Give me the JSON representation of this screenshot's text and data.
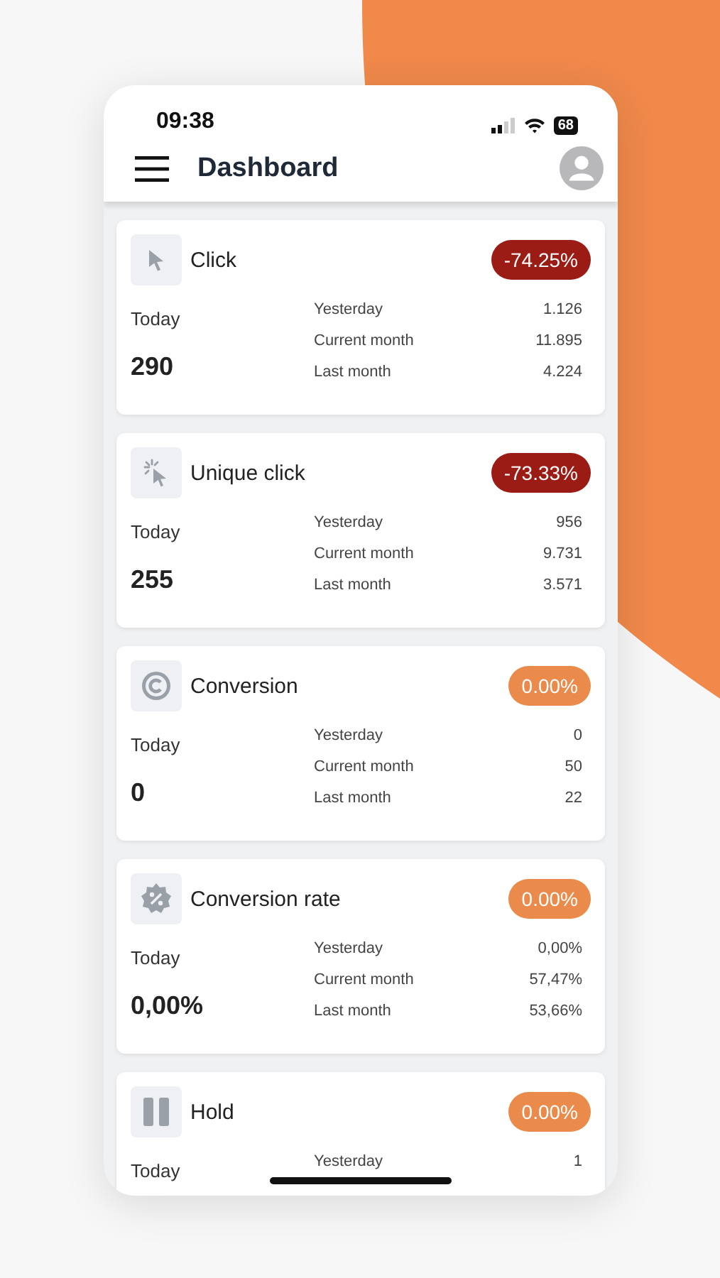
{
  "status_bar": {
    "time": "09:38",
    "battery": "68"
  },
  "header": {
    "title": "Dashboard"
  },
  "cards": [
    {
      "kind": "click",
      "title": "Click",
      "trend": {
        "kind": "negative",
        "text": "-74.25%"
      },
      "today_label": "Today",
      "today_value": "290",
      "stats": [
        {
          "label": "Yesterday",
          "value": "1.126"
        },
        {
          "label": "Current month",
          "value": "11.895"
        },
        {
          "label": "Last month",
          "value": "4.224"
        }
      ]
    },
    {
      "kind": "unique-click",
      "title": "Unique click",
      "trend": {
        "kind": "negative",
        "text": "-73.33%"
      },
      "today_label": "Today",
      "today_value": "255",
      "stats": [
        {
          "label": "Yesterday",
          "value": "956"
        },
        {
          "label": "Current month",
          "value": "9.731"
        },
        {
          "label": "Last month",
          "value": "3.571"
        }
      ]
    },
    {
      "kind": "conversion",
      "title": "Conversion",
      "trend": {
        "kind": "neutral",
        "text": "0.00%"
      },
      "today_label": "Today",
      "today_value": "0",
      "stats": [
        {
          "label": "Yesterday",
          "value": "0"
        },
        {
          "label": "Current month",
          "value": "50"
        },
        {
          "label": "Last month",
          "value": "22"
        }
      ]
    },
    {
      "kind": "rate",
      "title": "Conversion rate",
      "trend": {
        "kind": "neutral",
        "text": "0.00%"
      },
      "today_label": "Today",
      "today_value": "0,00%",
      "stats": [
        {
          "label": "Yesterday",
          "value": "0,00%"
        },
        {
          "label": "Current month",
          "value": "57,47%"
        },
        {
          "label": "Last month",
          "value": "53,66%"
        }
      ]
    },
    {
      "kind": "hold",
      "title": "Hold",
      "trend": {
        "kind": "neutral",
        "text": "0.00%"
      },
      "today_label": "Today",
      "stats": [
        {
          "label": "Yesterday",
          "value": "1"
        }
      ]
    }
  ]
}
